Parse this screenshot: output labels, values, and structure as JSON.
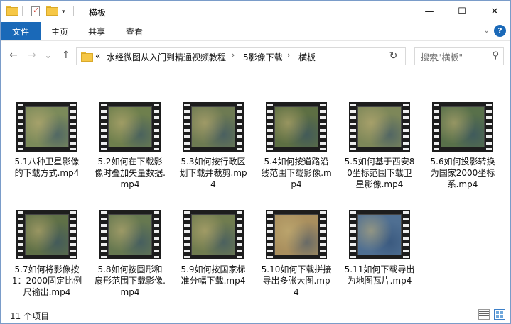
{
  "window": {
    "title": "横板",
    "minimize_glyph": "—",
    "maximize_glyph": "☐",
    "close_glyph": "✕"
  },
  "ribbon": {
    "tabs": [
      "文件",
      "主页",
      "共享",
      "查看"
    ],
    "expand_glyph": "⌄",
    "help_glyph": "?"
  },
  "nav": {
    "back_glyph": "←",
    "forward_glyph": "→",
    "recent_glyph": "⌄",
    "up_glyph": "↑",
    "overflow": "«",
    "breadcrumbs": [
      "水经微图从入门到精通视频教程",
      "5影像下载",
      "横板"
    ],
    "crumb_sep": "›",
    "dropdown_glyph": "⌄",
    "refresh_glyph": "↻"
  },
  "search": {
    "placeholder": "搜索\"横板\"",
    "icon_glyph": "⚲"
  },
  "files": [
    {
      "name": "5.1八种卫星影像的下载方式.mp4",
      "thumb": "#7b8a5a"
    },
    {
      "name": "5.2如何在下载影像时叠加矢量数据.mp4",
      "thumb": "#6e7f4d"
    },
    {
      "name": "5.3如何按行政区划下载并裁剪.mp4",
      "thumb": "#6d7a52"
    },
    {
      "name": "5.4如何按道路沿线范围下载影像.mp4",
      "thumb": "#5d6f43"
    },
    {
      "name": "5.5如何基于西安80坐标范围下载卫星影像.mp4",
      "thumb": "#7d8759"
    },
    {
      "name": "5.6如何投影转换为国家2000坐标系.mp4",
      "thumb": "#58704a"
    },
    {
      "name": "5.7如何将影像按1：2000固定比例尺输出.mp4",
      "thumb": "#5f7047"
    },
    {
      "name": "5.8如何按圆形和扇形范围下载影像.mp4",
      "thumb": "#667850"
    },
    {
      "name": "5.9如何按国家标准分幅下载.mp4",
      "thumb": "#707c4f"
    },
    {
      "name": "5.10如何下载拼接导出多张大图.mp4",
      "thumb": "#a98f5e"
    },
    {
      "name": "5.11如何下载导出为地图瓦片.mp4",
      "thumb": "#4f6f92"
    }
  ],
  "status": {
    "item_count": "11 个项目"
  }
}
